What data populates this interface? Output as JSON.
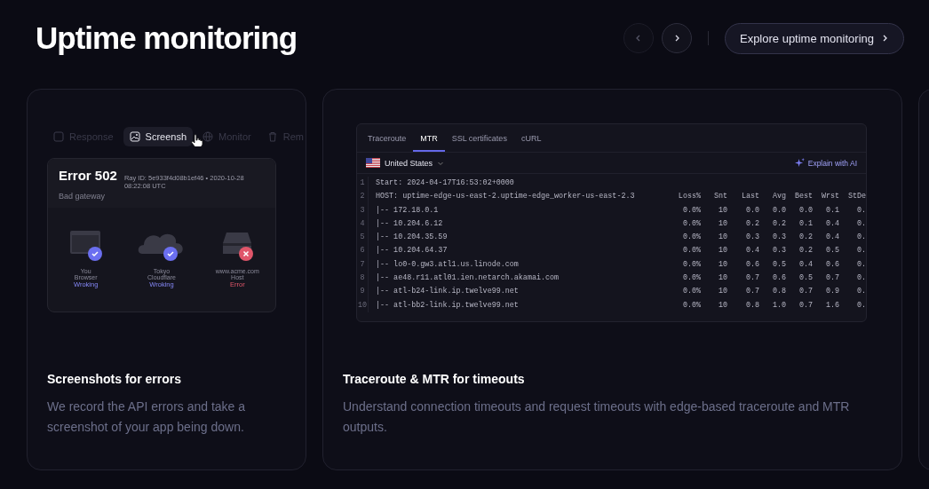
{
  "title": "Uptime monitoring",
  "nav": {
    "prev_disabled": true,
    "next_disabled": false
  },
  "explore_button": {
    "label": "Explore uptime monitoring"
  },
  "cards": [
    {
      "kind": "screenshot",
      "heading": "Screenshots for errors",
      "description": "We record the API errors and take a screenshot of your app being down.",
      "preview": {
        "tabs": [
          {
            "label": "Response",
            "kind": "square",
            "selected": false
          },
          {
            "label": "Screensh",
            "kind": "image",
            "selected": true
          },
          {
            "label": "Monitor",
            "kind": "globe",
            "selected": false
          },
          {
            "label": "Rem",
            "kind": "trash",
            "selected": false
          }
        ],
        "error_title": "Error 502",
        "ray_id": "Ray ID: 5e933f4d08b1ef46 • 2020-10-28 08:22:08 UTC",
        "error_subtitle": "Bad gateway",
        "nodes": [
          {
            "kind": "browser",
            "caption": "You",
            "name": "Browser",
            "status": "Wroking",
            "ok": true
          },
          {
            "kind": "cloud",
            "caption": "Tokyo",
            "name": "Cloudflare",
            "status": "Wroking",
            "ok": true
          },
          {
            "kind": "server",
            "caption": "www.acme.com",
            "name": "Host",
            "status": "Error",
            "ok": false
          }
        ]
      }
    },
    {
      "kind": "mtr",
      "heading": "Traceroute & MTR for timeouts",
      "description": "Understand connection timeouts and request timeouts with edge-based traceroute and MTR outputs.",
      "preview": {
        "tabs": [
          {
            "label": "Traceroute",
            "selected": false
          },
          {
            "label": "MTR",
            "selected": true
          },
          {
            "label": "SSL certificates",
            "selected": false
          },
          {
            "label": "cURL",
            "selected": false
          }
        ],
        "region": "United States",
        "line_numbers": [
          "1",
          "2",
          "3",
          "4",
          "5",
          "6",
          "7",
          "8",
          "9",
          "10"
        ],
        "ai_button": "Explain with AI",
        "start_line": "Start: 2024-04-17T16:53:02+0000",
        "columns": [
          "HOST: uptime-edge-us-east-2.uptime-edge_worker-us-east-2.3",
          "Loss%",
          "Snt",
          "Last",
          "Avg",
          "Best",
          "Wrst",
          "StDe"
        ],
        "rows": [
          [
            "|-- 172.18.0.1",
            "0.0%",
            "10",
            "0.0",
            "0.0",
            "0.0",
            "0.1",
            "0."
          ],
          [
            "|-- 10.204.6.12",
            "0.0%",
            "10",
            "0.2",
            "0.2",
            "0.1",
            "0.4",
            "0."
          ],
          [
            "|-- 10.204.35.59",
            "0.0%",
            "10",
            "0.3",
            "0.3",
            "0.2",
            "0.4",
            "0."
          ],
          [
            "|-- 10.204.64.37",
            "0.0%",
            "10",
            "0.4",
            "0.3",
            "0.2",
            "0.5",
            "0."
          ],
          [
            "|-- lo0-0.gw3.atl1.us.linode.com",
            "0.0%",
            "10",
            "0.6",
            "0.5",
            "0.4",
            "0.6",
            "0."
          ],
          [
            "|-- ae48.r11.atl01.ien.netarch.akamai.com",
            "0.0%",
            "10",
            "0.7",
            "0.6",
            "0.5",
            "0.7",
            "0."
          ],
          [
            "|-- atl-b24-link.ip.twelve99.net",
            "0.0%",
            "10",
            "0.7",
            "0.8",
            "0.7",
            "0.9",
            "0."
          ],
          [
            "|-- atl-bb2-link.ip.twelve99.net",
            "0.0%",
            "10",
            "0.8",
            "1.0",
            "0.7",
            "1.6",
            "0."
          ]
        ]
      }
    }
  ]
}
